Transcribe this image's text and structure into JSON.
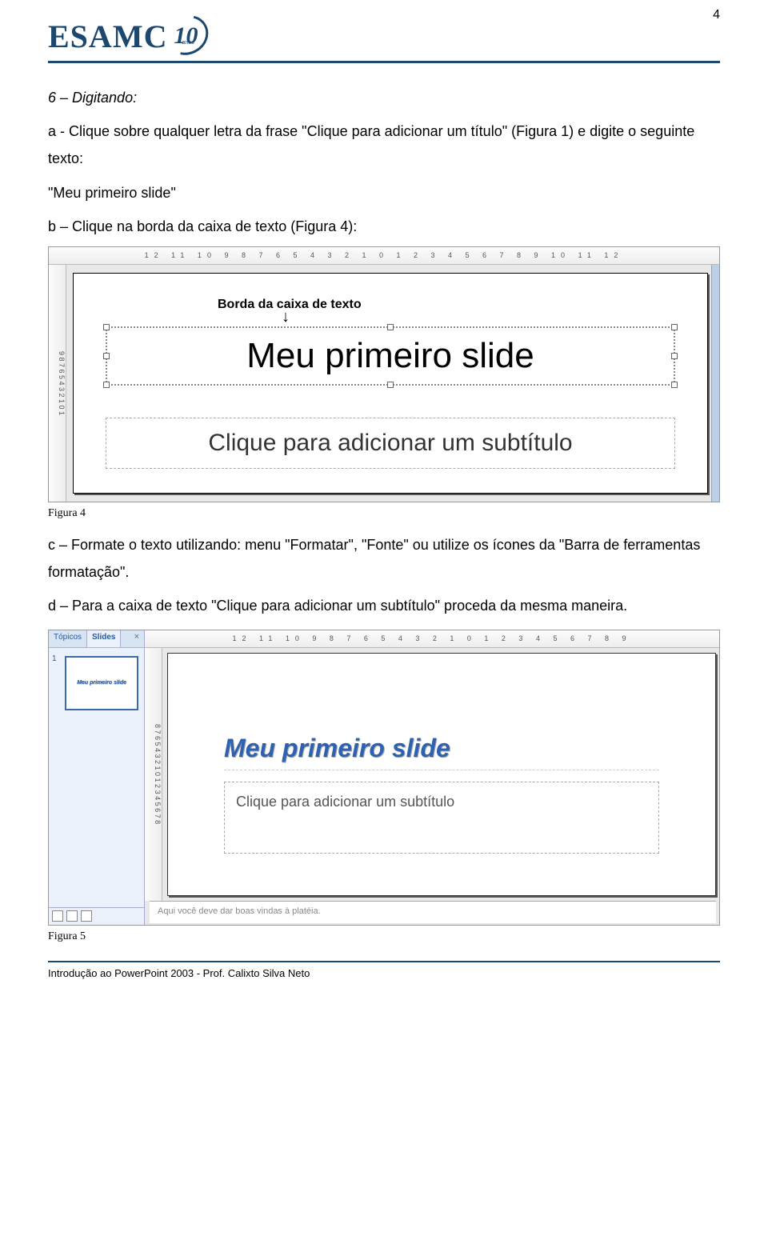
{
  "page_number": "4",
  "logo": {
    "text": "ESAMC",
    "badge_number": "10",
    "badge_sub": "anos"
  },
  "section": {
    "heading": "6 – Digitando:",
    "step_a": "a - Clique sobre qualquer letra da frase \"Clique para adicionar um título\" (Figura 1) e digite o seguinte texto:",
    "step_a_text": "\"Meu primeiro slide\"",
    "step_b": "b – Clique na borda da caixa de texto (Figura 4):",
    "step_c": "c – Formate o texto utilizando: menu \"Formatar\", \"Fonte\" ou utilize os ícones da \"Barra de ferramentas formatação\".",
    "step_d": "d – Para a caixa de texto \"Clique para adicionar um subtítulo\" proceda da mesma maneira."
  },
  "fig4": {
    "ruler_h": "12 11 10 9 8 7 6 5 4 3 2 1 0 1 2 3 4 5 6 7 8 9 10 11 12",
    "ruler_v": "9 8 7 6 5 4 3 2 1 0 1",
    "annotation": "Borda da caixa de texto",
    "title": "Meu primeiro slide",
    "subtitle": "Clique para adicionar um subtítulo",
    "caption": "Figura 4"
  },
  "fig5": {
    "tab1": "Tópicos",
    "tab2": "Slides",
    "thumb_num": "1",
    "thumb_title": "Meu primeiro slide",
    "ruler_h": "12 11 10 9 8 7 6 5 4 3 2 1 0 1 2 3 4 5 6 7 8 9",
    "ruler_v": "8 7 6 5 4 3 2 1 0 1 2 3 4 5 6 7 8",
    "slide_title": "Meu primeiro slide",
    "slide_sub": "Clique para adicionar um subtítulo",
    "notes": "Aqui você deve dar boas vindas à platéia.",
    "caption": "Figura 5"
  },
  "footer": "Introdução ao PowerPoint 2003 - Prof. Calixto Silva Neto"
}
